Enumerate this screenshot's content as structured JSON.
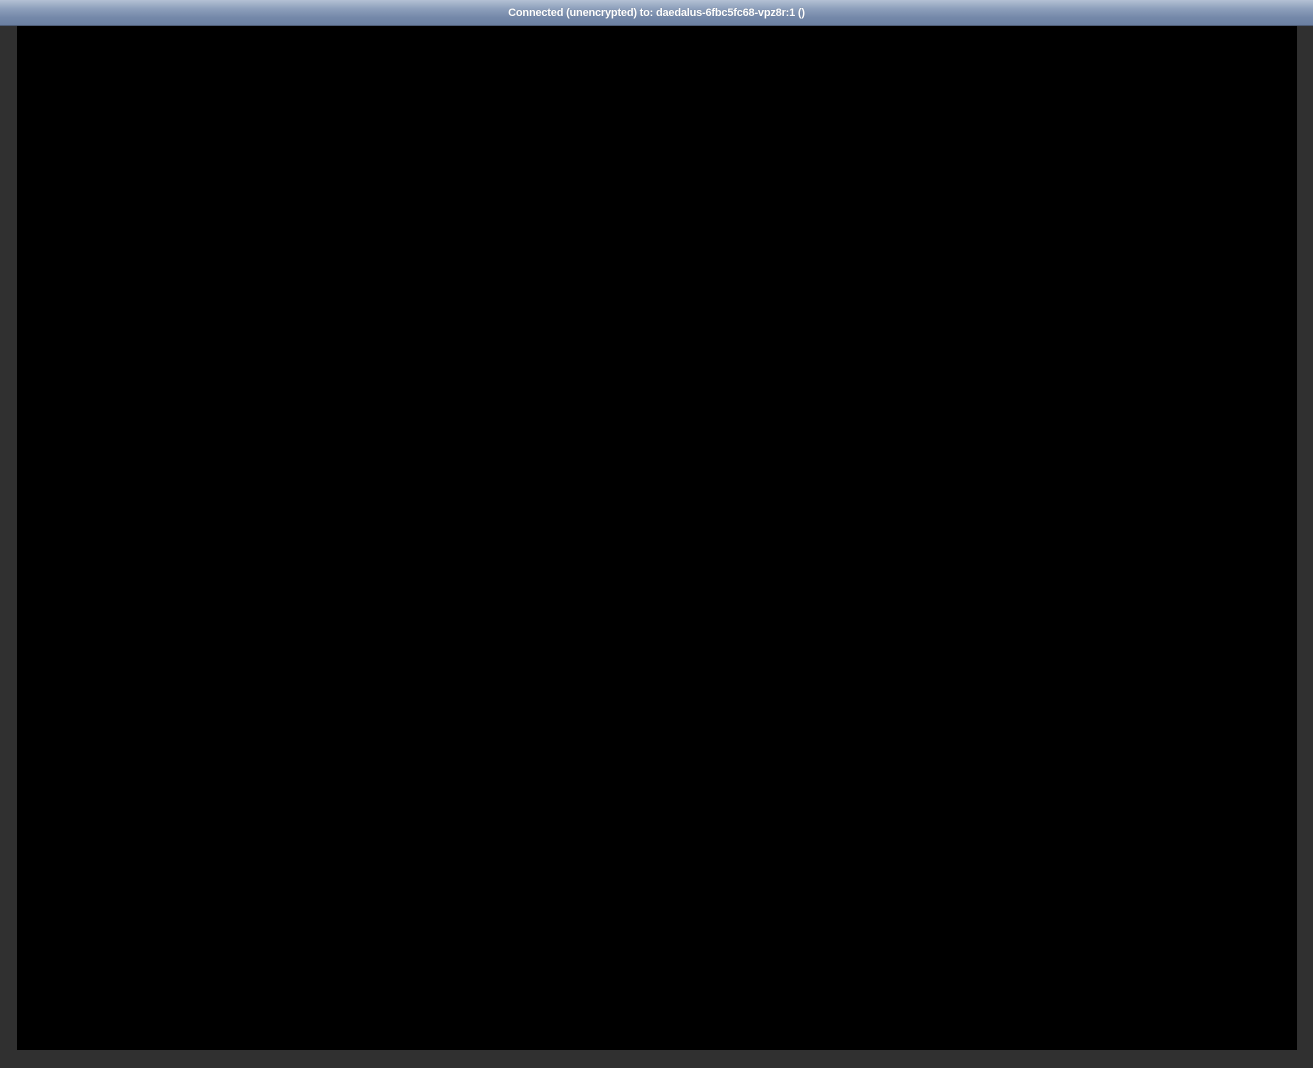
{
  "status_bar": {
    "text": "Connected (unencrypted) to: daedalus-6fbc5fc68-vpz8r:1 ()"
  },
  "colors": {
    "frame_background": "#303030",
    "remote_screen_background": "#000000",
    "status_bar_top": "#b4c1d4",
    "status_bar_bottom": "#6b80a2",
    "status_text": "#ffffff"
  }
}
